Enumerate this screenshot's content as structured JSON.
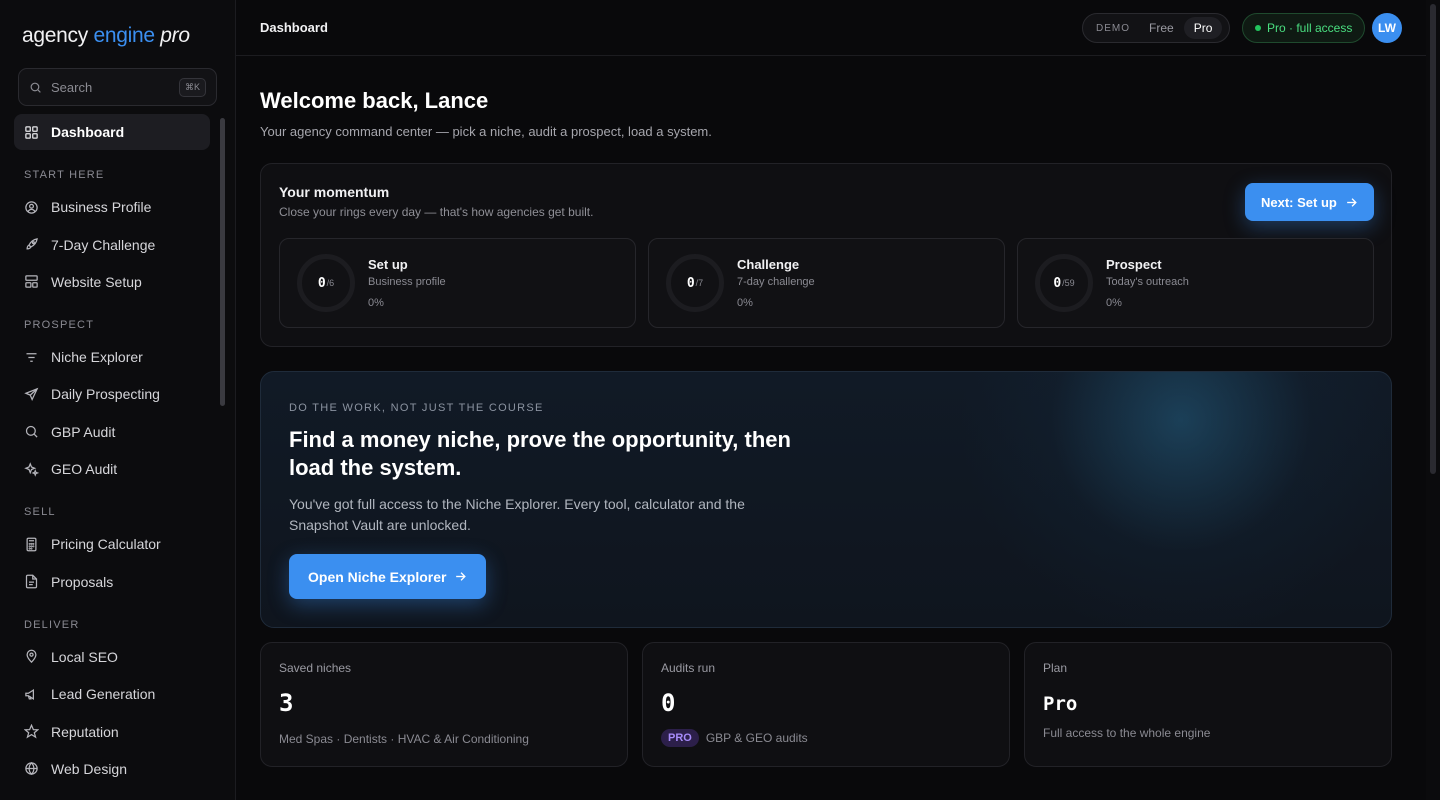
{
  "logo": {
    "part1": "agency ",
    "part2": "engine",
    "part3": " pro"
  },
  "search": {
    "placeholder": "Search",
    "shortcut": "⌘K"
  },
  "nav": {
    "dashboard": "Dashboard",
    "sections": {
      "start_here": "START HERE",
      "prospect": "PROSPECT",
      "sell": "SELL",
      "deliver": "DELIVER"
    },
    "items": {
      "business_profile": "Business Profile",
      "challenge": "7-Day Challenge",
      "website_setup": "Website Setup",
      "niche_explorer": "Niche Explorer",
      "daily_prospecting": "Daily Prospecting",
      "gbp_audit": "GBP Audit",
      "geo_audit": "GEO Audit",
      "pricing_calculator": "Pricing Calculator",
      "proposals": "Proposals",
      "local_seo": "Local SEO",
      "lead_generation": "Lead Generation",
      "reputation": "Reputation",
      "web_design": "Web Design"
    }
  },
  "topbar": {
    "title": "Dashboard",
    "demo_label": "DEMO",
    "opt_free": "Free",
    "opt_pro": "Pro",
    "access": "Pro · full access",
    "avatar": "LW"
  },
  "welcome": {
    "title": "Welcome back, Lance",
    "subtitle": "Your agency command center — pick a niche, audit a prospect, load a system."
  },
  "momentum": {
    "title": "Your momentum",
    "subtitle": "Close your rings every day — that's how agencies get built.",
    "button": "Next: Set up",
    "rings": [
      {
        "num": "0",
        "den": "/6",
        "title": "Set up",
        "sub": "Business profile",
        "pct": "0%"
      },
      {
        "num": "0",
        "den": "/7",
        "title": "Challenge",
        "sub": "7-day challenge",
        "pct": "0%"
      },
      {
        "num": "0",
        "den": "/59",
        "title": "Prospect",
        "sub": "Today's outreach",
        "pct": "0%"
      }
    ]
  },
  "hero": {
    "eyebrow": "DO THE WORK, NOT JUST THE COURSE",
    "title": "Find a money niche, prove the opportunity, then load the system.",
    "body": "You've got full access to the Niche Explorer. Every tool, calculator and the Snapshot Vault are unlocked.",
    "button": "Open Niche Explorer"
  },
  "stats": {
    "saved": {
      "label": "Saved niches",
      "value": "3",
      "desc": "Med Spas · Dentists · HVAC & Air Conditioning"
    },
    "audits": {
      "label": "Audits run",
      "value": "0",
      "badge": "PRO",
      "desc": "GBP & GEO audits"
    },
    "plan": {
      "label": "Plan",
      "value": "Pro",
      "desc": "Full access to the whole engine"
    }
  },
  "colors": {
    "accent": "#3b8ff0",
    "success": "#22c55e",
    "pro_badge": "#a78bfa"
  }
}
